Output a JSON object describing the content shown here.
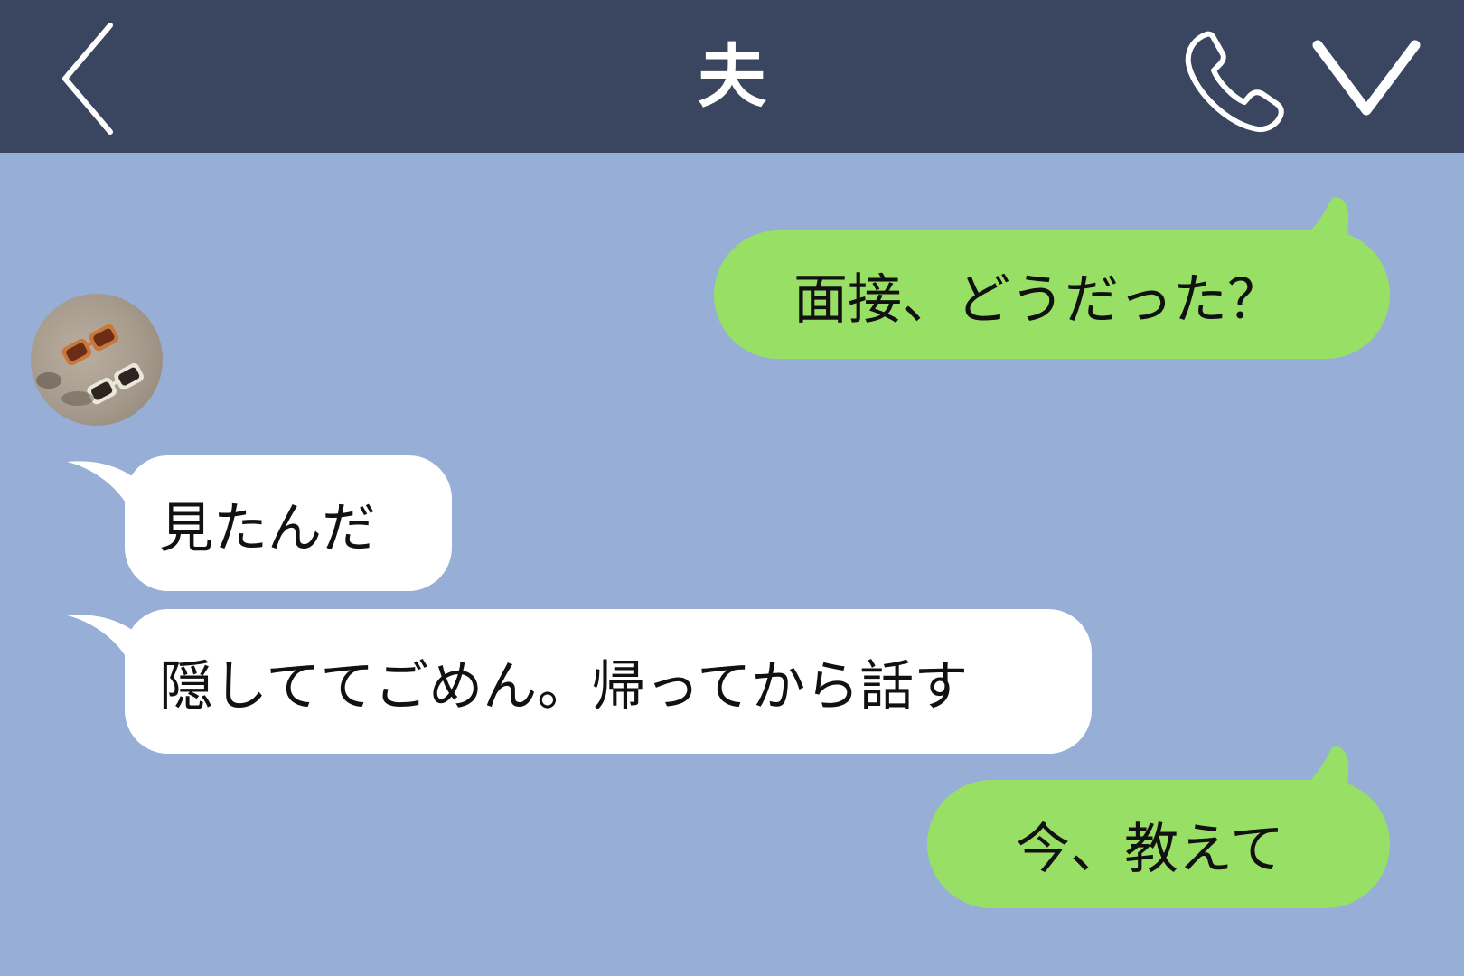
{
  "header": {
    "title": "夫",
    "back_icon": "chevron-left-icon",
    "call_icon": "phone-icon",
    "menu_icon": "chevron-down-icon",
    "background_color": "#3a4560"
  },
  "chat": {
    "background_color": "#97aed6",
    "contact_avatar": "avatar-sunglasses",
    "messages": [
      {
        "sender": "me",
        "text": "面接、どうだった？"
      },
      {
        "sender": "contact",
        "text": "見たんだ"
      },
      {
        "sender": "contact",
        "text": "隠しててごめん。帰ってから話す"
      },
      {
        "sender": "me",
        "text": "今、教えて"
      }
    ],
    "outgoing_color": "#98e065",
    "incoming_color": "#ffffff"
  }
}
